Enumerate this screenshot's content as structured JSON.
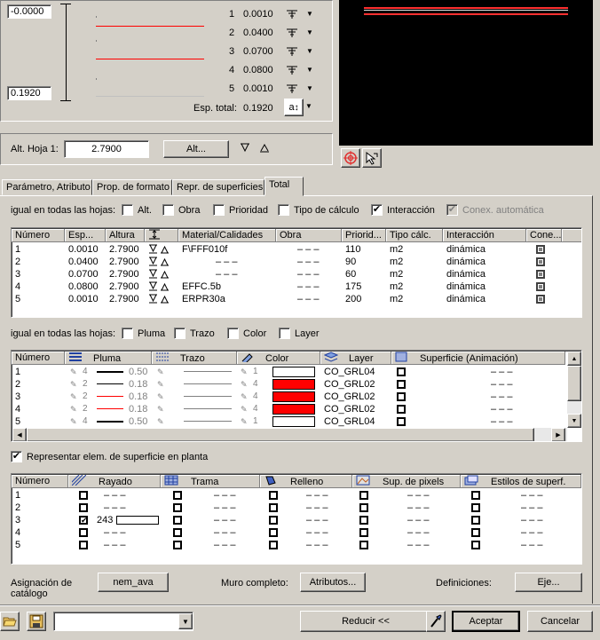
{
  "layers_panel": {
    "top_value": "-0.0000",
    "bottom_value": "0.1920",
    "rows": [
      {
        "num": "1",
        "value": "0.0010"
      },
      {
        "num": "2",
        "value": "0.0400"
      },
      {
        "num": "3",
        "value": "0.0700"
      },
      {
        "num": "4",
        "value": "0.0800"
      },
      {
        "num": "5",
        "value": "0.0010"
      }
    ],
    "total_label": "Esp. total:",
    "total_value": "0.1920",
    "align_glyph": "a"
  },
  "height": {
    "label": "Alt. Hoja 1:",
    "value": "2.7900",
    "button": "Alt..."
  },
  "tabs": [
    "Parámetro, Atributo",
    "Prop. de formato",
    "Repr. de superficies",
    "Total"
  ],
  "filter1": {
    "label": "igual en todas las hojas:",
    "options": [
      {
        "label": "Alt.",
        "checked": false
      },
      {
        "label": "Obra",
        "checked": false
      },
      {
        "label": "Prioridad",
        "checked": false
      },
      {
        "label": "Tipo de cálculo",
        "checked": false
      },
      {
        "label": "Interacción",
        "checked": true
      },
      {
        "label": "Conex. automática",
        "checked": true,
        "disabled": true
      }
    ]
  },
  "table1": {
    "headers": [
      "Número",
      "Esp...",
      "Altura",
      "",
      "Material/Calidades",
      "Obra",
      "Priorid...",
      "Tipo cálc.",
      "Interacción",
      "Cone..."
    ],
    "rows": [
      {
        "num": "1",
        "esp": "0.0010",
        "alt": "2.7900",
        "mat": "F\\FFF010f",
        "obra": "– – –",
        "prio": "110",
        "tipo": "m2",
        "inter": "dinámica"
      },
      {
        "num": "2",
        "esp": "0.0400",
        "alt": "2.7900",
        "mat": "– – –",
        "obra": "– – –",
        "prio": "90",
        "tipo": "m2",
        "inter": "dinámica"
      },
      {
        "num": "3",
        "esp": "0.0700",
        "alt": "2.7900",
        "mat": "– – –",
        "obra": "– – –",
        "prio": "60",
        "tipo": "m2",
        "inter": "dinámica"
      },
      {
        "num": "4",
        "esp": "0.0800",
        "alt": "2.7900",
        "mat": "EFFC.5b",
        "obra": "– – –",
        "prio": "175",
        "tipo": "m2",
        "inter": "dinámica"
      },
      {
        "num": "5",
        "esp": "0.0010",
        "alt": "2.7900",
        "mat": "ERPR30a",
        "obra": "– – –",
        "prio": "200",
        "tipo": "m2",
        "inter": "dinámica"
      }
    ]
  },
  "filter2": {
    "label": "igual en todas las hojas:",
    "options": [
      {
        "label": "Pluma",
        "checked": false
      },
      {
        "label": "Trazo",
        "checked": false
      },
      {
        "label": "Color",
        "checked": false
      },
      {
        "label": "Layer",
        "checked": false
      }
    ]
  },
  "table2": {
    "headers": [
      "Número",
      "Pluma",
      "Trazo",
      "Color",
      "Layer",
      "Superficie (Animación)"
    ],
    "rows": [
      {
        "num": "1",
        "pen": "0.50",
        "pen_idx": "4",
        "color_idx": "1",
        "color": "#ffffff",
        "line": "#000000",
        "layer": "CO_GRL04",
        "surf": "– – –"
      },
      {
        "num": "2",
        "pen": "0.18",
        "pen_idx": "2",
        "color_idx": "4",
        "color": "#ff0000",
        "line": "#000000",
        "layer": "CO_GRL02",
        "surf": "– – –"
      },
      {
        "num": "3",
        "pen": "0.18",
        "pen_idx": "2",
        "color_idx": "4",
        "color": "#ff0000",
        "line": "#ff0000",
        "layer": "CO_GRL02",
        "surf": "– – –"
      },
      {
        "num": "4",
        "pen": "0.18",
        "pen_idx": "2",
        "color_idx": "4",
        "color": "#ff0000",
        "line": "#ff0000",
        "layer": "CO_GRL02",
        "surf": "– – –"
      },
      {
        "num": "5",
        "pen": "0.50",
        "pen_idx": "4",
        "color_idx": "1",
        "color": "#ffffff",
        "line": "#000000",
        "layer": "CO_GRL04",
        "surf": "– – –"
      }
    ]
  },
  "represent": {
    "label": "Representar elem. de superficie en planta",
    "checked": true
  },
  "table3": {
    "headers": [
      "Número",
      "Rayado",
      "Trama",
      "Relleno",
      "Sup. de pixels",
      "Estilos de superf."
    ],
    "rows": [
      {
        "num": "1",
        "hatch_checked": false,
        "hatch": "– – –",
        "trama": "– – –",
        "relleno": "– – –",
        "pix": "– – –",
        "est": "– – –"
      },
      {
        "num": "2",
        "hatch_checked": false,
        "hatch": "– – –",
        "trama": "– – –",
        "relleno": "– – –",
        "pix": "– – –",
        "est": "– – –"
      },
      {
        "num": "3",
        "hatch_checked": true,
        "hatch": "243",
        "trama": "– – –",
        "relleno": "– – –",
        "pix": "– – –",
        "est": "– – –"
      },
      {
        "num": "4",
        "hatch_checked": false,
        "hatch": "– – –",
        "trama": "– – –",
        "relleno": "– – –",
        "pix": "– – –",
        "est": "– – –"
      },
      {
        "num": "5",
        "hatch_checked": false,
        "hatch": "– – –",
        "trama": "– – –",
        "relleno": "– – –",
        "pix": "– – –",
        "est": "– – –"
      }
    ]
  },
  "bottom": {
    "catalog_label": "Asignación de catálogo",
    "catalog_button": "nem_ava",
    "muro_label": "Muro completo:",
    "muro_button": "Atributos...",
    "def_label": "Definiciones:",
    "def_button": "Eje...",
    "reducir": "Reducir <<",
    "aceptar": "Aceptar",
    "cancelar": "Cancelar",
    "combo_value": ""
  }
}
